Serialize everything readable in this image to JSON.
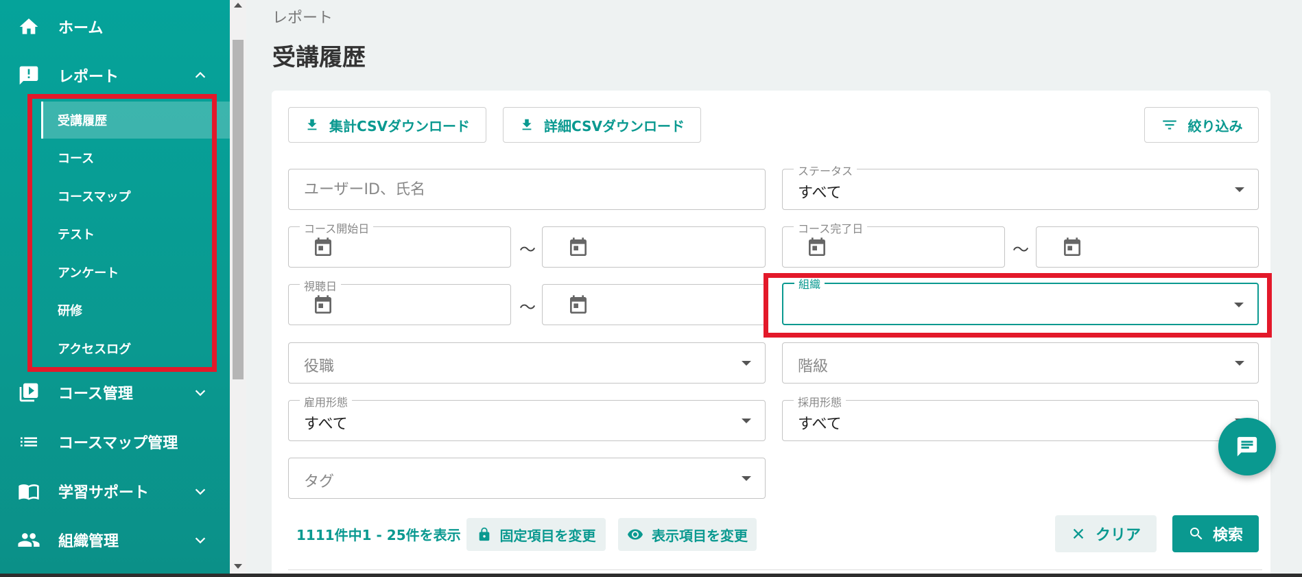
{
  "sidebar": {
    "home": "ホーム",
    "report": "レポート",
    "report_sub": [
      "受講履歴",
      "コース",
      "コースマップ",
      "テスト",
      "アンケート",
      "研修",
      "アクセスログ"
    ],
    "course_admin": "コース管理",
    "coursemap_admin": "コースマップ管理",
    "learning_support": "学習サポート",
    "org_admin": "組織管理"
  },
  "breadcrumb": "レポート",
  "page_title": "受講履歴",
  "toolbar": {
    "summary_csv": "集計CSVダウンロード",
    "detail_csv": "詳細CSVダウンロード",
    "filter": "絞り込み"
  },
  "filters": {
    "user_placeholder": "ユーザーID、氏名",
    "status_label": "ステータス",
    "status_value": "すべて",
    "course_start_label": "コース開始日",
    "course_end_label": "コース完了日",
    "view_date_label": "視聴日",
    "range_sep": "〜",
    "org_label": "組織",
    "position_placeholder": "役職",
    "rank_placeholder": "階級",
    "employment_label": "雇用形態",
    "employment_value": "すべて",
    "hiring_label": "採用形態",
    "hiring_value": "すべて",
    "tag_placeholder": "タグ"
  },
  "results": {
    "count_text": "1111件中1 - 25件を表示",
    "fixed_cols": "固定項目を変更",
    "display_cols": "表示項目を変更",
    "clear": "クリア",
    "search": "検索"
  },
  "colors": {
    "accent": "#0a9990",
    "highlight": "#e3192a"
  }
}
